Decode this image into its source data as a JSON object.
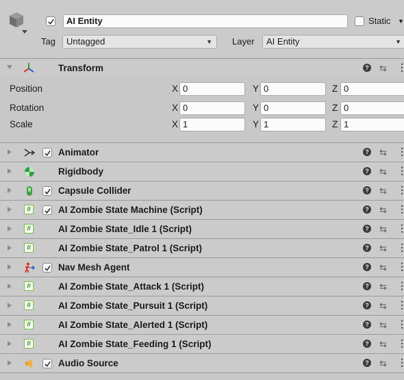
{
  "object": {
    "active": true,
    "name": "AI Entity",
    "static_label": "Static",
    "static_checked": false,
    "tag_label": "Tag",
    "tag_value": "Untagged",
    "layer_label": "Layer",
    "layer_value": "AI Entity"
  },
  "transform": {
    "title": "Transform",
    "rows": [
      {
        "label": "Position",
        "x": "0",
        "y": "0",
        "z": "0"
      },
      {
        "label": "Rotation",
        "x": "0",
        "y": "0",
        "z": "0"
      },
      {
        "label": "Scale",
        "x": "1",
        "y": "1",
        "z": "1"
      }
    ],
    "axis_x": "X",
    "axis_y": "Y",
    "axis_z": "Z"
  },
  "components": [
    {
      "name": "Animator",
      "checkbox": true,
      "icon": "animator-icon"
    },
    {
      "name": "Rigidbody",
      "checkbox": false,
      "icon": "rigidbody-icon"
    },
    {
      "name": "Capsule Collider",
      "checkbox": true,
      "icon": "capsule-collider-icon"
    },
    {
      "name": "AI Zombie State Machine (Script)",
      "checkbox": true,
      "icon": "script-icon"
    },
    {
      "name": "AI Zombie State_Idle 1 (Script)",
      "checkbox": false,
      "icon": "script-icon"
    },
    {
      "name": "AI Zombie State_Patrol 1 (Script)",
      "checkbox": false,
      "icon": "script-icon"
    },
    {
      "name": "Nav Mesh Agent",
      "checkbox": true,
      "icon": "nav-mesh-agent-icon"
    },
    {
      "name": "AI Zombie State_Attack 1 (Script)",
      "checkbox": false,
      "icon": "script-icon"
    },
    {
      "name": "AI Zombie State_Pursuit 1 (Script)",
      "checkbox": false,
      "icon": "script-icon"
    },
    {
      "name": "AI Zombie State_Alerted 1 (Script)",
      "checkbox": false,
      "icon": "script-icon"
    },
    {
      "name": "AI Zombie State_Feeding 1 (Script)",
      "checkbox": false,
      "icon": "script-icon"
    },
    {
      "name": "Audio Source",
      "checkbox": true,
      "icon": "audio-source-icon"
    }
  ],
  "glyphs": {
    "help": "?",
    "preset": "⇆",
    "menu": "⋮",
    "hash": "#"
  }
}
